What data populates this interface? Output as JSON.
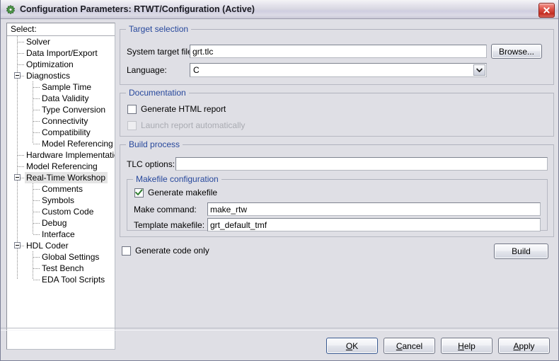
{
  "window": {
    "title": "Configuration Parameters: RTWT/Configuration (Active)",
    "icon": "simulink-gear-icon",
    "close_label": "close-icon"
  },
  "sidebar": {
    "header": "Select:",
    "items": [
      {
        "label": "Solver",
        "level": 1,
        "expander": "none",
        "selected": false
      },
      {
        "label": "Data Import/Export",
        "level": 1,
        "expander": "none",
        "selected": false
      },
      {
        "label": "Optimization",
        "level": 1,
        "expander": "none",
        "selected": false
      },
      {
        "label": "Diagnostics",
        "level": 1,
        "expander": "expanded",
        "selected": false
      },
      {
        "label": "Sample Time",
        "level": 2,
        "expander": "none",
        "selected": false
      },
      {
        "label": "Data Validity",
        "level": 2,
        "expander": "none",
        "selected": false
      },
      {
        "label": "Type Conversion",
        "level": 2,
        "expander": "none",
        "selected": false
      },
      {
        "label": "Connectivity",
        "level": 2,
        "expander": "none",
        "selected": false
      },
      {
        "label": "Compatibility",
        "level": 2,
        "expander": "none",
        "selected": false
      },
      {
        "label": "Model Referencing",
        "level": 2,
        "expander": "none",
        "selected": false
      },
      {
        "label": "Hardware Implementation",
        "level": 1,
        "expander": "none",
        "selected": false
      },
      {
        "label": "Model Referencing",
        "level": 1,
        "expander": "none",
        "selected": false
      },
      {
        "label": "Real-Time Workshop",
        "level": 1,
        "expander": "expanded",
        "selected": true
      },
      {
        "label": "Comments",
        "level": 2,
        "expander": "none",
        "selected": false
      },
      {
        "label": "Symbols",
        "level": 2,
        "expander": "none",
        "selected": false
      },
      {
        "label": "Custom Code",
        "level": 2,
        "expander": "none",
        "selected": false
      },
      {
        "label": "Debug",
        "level": 2,
        "expander": "none",
        "selected": false
      },
      {
        "label": "Interface",
        "level": 2,
        "expander": "none",
        "selected": false
      },
      {
        "label": "HDL Coder",
        "level": 1,
        "expander": "expanded",
        "selected": false
      },
      {
        "label": "Global Settings",
        "level": 2,
        "expander": "none",
        "selected": false
      },
      {
        "label": "Test Bench",
        "level": 2,
        "expander": "none",
        "selected": false
      },
      {
        "label": "EDA Tool Scripts",
        "level": 2,
        "expander": "none",
        "selected": false
      }
    ]
  },
  "target_selection": {
    "title": "Target selection",
    "system_target_file_label": "System target file:",
    "system_target_file_value": "grt.tlc",
    "browse_label": "Browse...",
    "language_label": "Language:",
    "language_value": "C"
  },
  "documentation": {
    "title": "Documentation",
    "generate_html_report_label": "Generate HTML report",
    "generate_html_report_checked": false,
    "launch_report_label": "Launch report automatically",
    "launch_report_checked": false,
    "launch_report_disabled": true
  },
  "build_process": {
    "title": "Build process",
    "tlc_options_label": "TLC options:",
    "tlc_options_value": "",
    "makefile_configuration": {
      "title": "Makefile configuration",
      "generate_makefile_label": "Generate makefile",
      "generate_makefile_checked": true,
      "make_command_label": "Make command:",
      "make_command_value": "make_rtw",
      "template_makefile_label": "Template makefile:",
      "template_makefile_value": "grt_default_tmf"
    },
    "generate_code_only_label": "Generate code only",
    "generate_code_only_checked": false,
    "build_label": "Build"
  },
  "footer": {
    "buttons": [
      {
        "label": "OK",
        "mnemonic_index": 0,
        "default": true
      },
      {
        "label": "Cancel",
        "mnemonic_index": 0,
        "default": false
      },
      {
        "label": "Help",
        "mnemonic_index": 0,
        "default": false
      },
      {
        "label": "Apply",
        "mnemonic_index": 0,
        "default": false
      }
    ]
  },
  "colors": {
    "dialog_background": "#dfdfe5",
    "group_title": "#27489c",
    "selection": "#e4e4e4",
    "close_button": "#c32d22",
    "checkmark": "#2f7d2f"
  }
}
